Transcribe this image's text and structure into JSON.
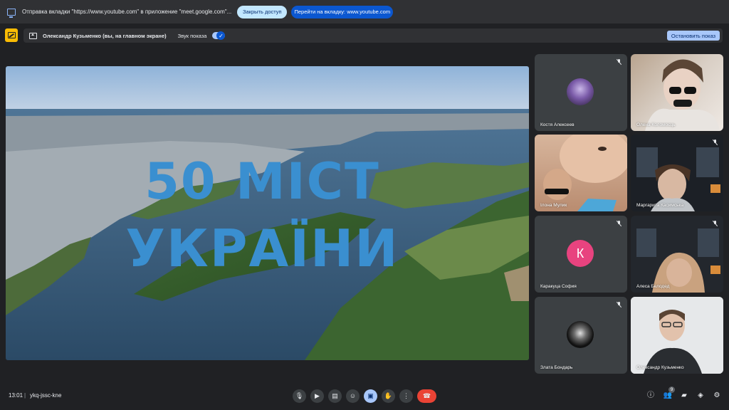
{
  "notification": {
    "text": "Отправка вкладки \"https://www.youtube.com\" в приложение \"meet.google.com\"...",
    "stop_access_label": "Закрыть доступ",
    "go_to_tab_label": "Перейти на вкладку: www.youtube.com"
  },
  "presenting": {
    "presenter_label": "Олександр Кузьменко (вы, на главном экране)",
    "sound_label": "Звук показа",
    "sound_enabled": true,
    "stop_label": "Остановить показ"
  },
  "stage": {
    "title_line1": "50 МІСТ",
    "title_line2": "УКРАЇНИ"
  },
  "participants": [
    {
      "name": "Костя Алексеев",
      "muted": true,
      "tile": "avatar-image"
    },
    {
      "name": "Олена Коломоєць",
      "muted": false,
      "tile": "video"
    },
    {
      "name": "Ілона Мулик",
      "muted": false,
      "tile": "video"
    },
    {
      "name": "Маргарита Касимська",
      "muted": true,
      "tile": "video"
    },
    {
      "name": "Каракуца София",
      "muted": true,
      "tile": "avatar-letter",
      "initial": "К",
      "avatar_color": "#e8437f"
    },
    {
      "name": "Алеса Белодед",
      "muted": true,
      "tile": "video"
    },
    {
      "name": "Злата Бондарь",
      "muted": true,
      "tile": "avatar-image"
    },
    {
      "name": "Олександр Кузьменко",
      "muted": false,
      "tile": "video"
    }
  ],
  "footer": {
    "time": "13:01",
    "separator": "|",
    "meeting_code": "ykq-jssc-kne",
    "participant_count": "9"
  },
  "controls": {
    "icons": [
      "mic-icon",
      "camera-icon",
      "captions-icon",
      "emoji-icon",
      "present-icon",
      "raise-hand-icon",
      "more-options-icon",
      "end-call-icon"
    ],
    "right_icons": [
      "info-icon",
      "people-icon",
      "chat-icon",
      "activities-icon",
      "host-controls-icon"
    ]
  },
  "colors": {
    "background": "#202124",
    "accent": "#a8c7fa",
    "end_call": "#ea4335",
    "title_blue": "#3a8fd0"
  }
}
